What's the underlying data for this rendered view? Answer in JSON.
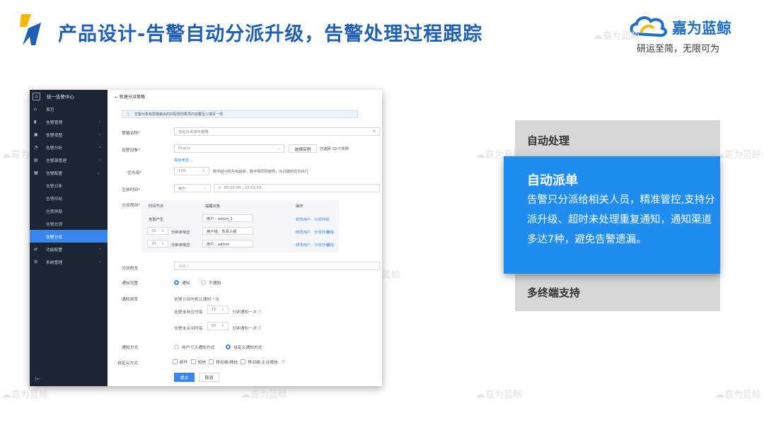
{
  "slide": {
    "title": "产品设计-告警自动分派升级，告警处理过程跟踪",
    "brand_name": "嘉为蓝鲸",
    "brand_slogan": "研运至简，无限可为",
    "watermark": "嘉为蓝鲸"
  },
  "app": {
    "sidebar": {
      "title": "统一告警中心",
      "items": [
        {
          "label": "首页",
          "icon": "home-icon",
          "glyph": "⌂",
          "arrow": ""
        },
        {
          "label": "告警管理",
          "icon": "alert-icon",
          "glyph": "▮",
          "arrow": "›"
        },
        {
          "label": "告警视图",
          "icon": "view-icon",
          "glyph": "▣",
          "arrow": "›"
        },
        {
          "label": "告警分析",
          "icon": "chart-icon",
          "glyph": "◔",
          "arrow": "›"
        },
        {
          "label": "告警源管理",
          "icon": "source-icon",
          "glyph": "▤",
          "arrow": "›"
        },
        {
          "label": "告警配置",
          "icon": "config-icon",
          "glyph": "▦",
          "arrow": "⌄"
        }
      ],
      "sub_items": [
        {
          "label": "告警对象",
          "active": false
        },
        {
          "label": "告警抑制",
          "active": false
        },
        {
          "label": "告警屏蔽",
          "active": false
        },
        {
          "label": "告警处理",
          "active": false
        },
        {
          "label": "告警分派",
          "active": true
        }
      ],
      "bottom_items": [
        {
          "label": "功能配置",
          "icon": "feature-icon",
          "glyph": "⇄",
          "arrow": "›"
        },
        {
          "label": "系统管理",
          "icon": "settings-icon",
          "glyph": "⚙",
          "arrow": "›"
        }
      ],
      "collapse_glyph": "|←"
    },
    "form": {
      "back_label": "← 新建分派策略",
      "tip": "告警对象和屏蔽路由的匹配规则再项内容覆至少填写一项",
      "name_label": "策略名称",
      "name_value": "自动分派演示策略",
      "object_label": "告警对象",
      "object_value": "Oracle",
      "select_instance_label": "选择实例",
      "selected_count": "已选择 10 个实例",
      "more_filter": "高级筛选 ⌄",
      "priority_label": "优先级",
      "priority_value": "100",
      "priority_hint": "数字越小优先级越高，数字相同则按照，先创建的优先执行",
      "time_label": "生效时间",
      "time_period": "每天",
      "time_range": "00:00:00 - 23:59:59",
      "rules_label": "分派规则",
      "rules_header": {
        "time": "时间节点",
        "target": "提醒对象",
        "ops": "操作"
      },
      "rules": [
        {
          "time": "告警产生",
          "minutes": "",
          "suffix": "",
          "target": "用户：amon_1",
          "ops": "修改用户 · 分派升级",
          "del": ""
        },
        {
          "time": "",
          "minutes": "30",
          "suffix": "分钟未响应",
          "target": "用户组：负责人组",
          "ops": "修改用户 · 分派升级",
          "del": "删除"
        },
        {
          "time": "",
          "minutes": "30",
          "suffix": "分钟未响应",
          "target": "用户：admin",
          "ops": "修改用户 · 分派升级",
          "del": "删除"
        }
      ],
      "remark_label": "分派附言",
      "remark_placeholder": "请输入",
      "notify_setting_label": "通知设置",
      "notify_on": "通知",
      "notify_off": "不通知",
      "notify_freq_label": "通知频率",
      "notify_freq_desc": "告警分派时默认通知一次",
      "unresp_label": "告警未响应时每",
      "unresp_value": "10",
      "unresp_unit": "分钟通知一次",
      "unclosed_label": "告警未关闭时每",
      "unclosed_value": "60",
      "unclosed_unit": "分钟通知一次",
      "notify_method_label": "通知方式",
      "method_personal": "用户个人通知方式",
      "method_custom": "自定义通知方式",
      "custom_label": "自定义方式",
      "channels": [
        "邮件",
        "短信",
        "移动端-微信",
        "移动端-企业微信"
      ],
      "submit_label": "提交",
      "cancel_label": "取消"
    }
  },
  "features": {
    "auto_process": "自动处理",
    "auto_dispatch_title": "自动派单",
    "auto_dispatch_desc": "告警只分派给相关人员，精准管控,支持分派升级、超时未处理重复通知，通知渠道多达7种，避免告警遗漏。",
    "multi_terminal": "多终端支持"
  },
  "colors": {
    "title_blue": "#1f5fb4",
    "card_blue": "#1f8cf0",
    "card_gray": "#d7d7d7",
    "sidebar_bg": "#1c2533",
    "primary": "#3a86ef"
  }
}
